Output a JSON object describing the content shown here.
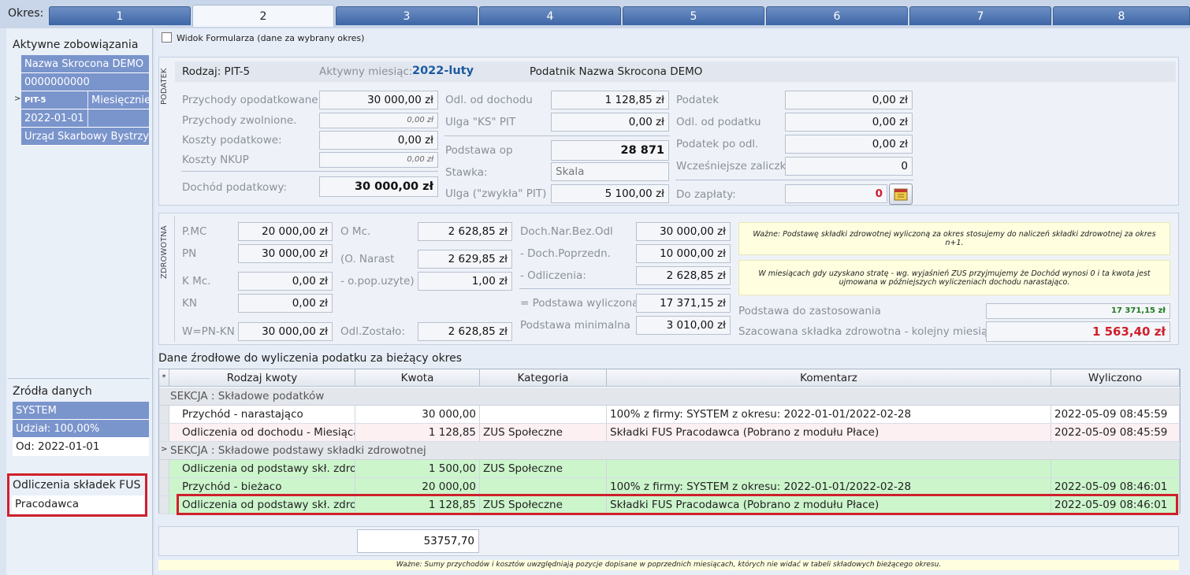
{
  "tabs": {
    "okres_label": "Okres:",
    "items": [
      "1",
      "2",
      "3",
      "4",
      "5",
      "6",
      "7",
      "8"
    ],
    "active_index": 1
  },
  "left": {
    "aktywne_title": "Aktywne zobowiązania",
    "row_name": "Nazwa Skrocona DEMO",
    "row_nip": "0000000000",
    "row_type": "PIT-5",
    "row_period": "Miesięcznie",
    "row_date": "2022-01-01",
    "row_office": "Urząd Skarbowy Bystrzy",
    "zrodla_title": "Źródła danych",
    "zrodla_system": "SYSTEM",
    "zrodla_udzial": "Udział: 100,00%",
    "zrodla_od": "Od: 2022-01-01",
    "fus_title": "Odliczenia składek FUS",
    "fus_value": "Pracodawca"
  },
  "form": {
    "view_label": "Widok Formularza (dane za wybrany okres)"
  },
  "podatek": {
    "section_label": "PODATEK",
    "rodzaj": "Rodzaj: PIT-5",
    "aktywny_label": "Aktywny miesiąc:",
    "aktywny_value": "2022-luty",
    "podatnik": "Podatnik Nazwa Skrocona DEMO",
    "przychody_opod_label": "Przychody opodatkowane:",
    "przychody_opod": "30 000,00 zł",
    "przychody_zw_label": "Przychody zwolnione.",
    "przychody_zw": "0,00 zł",
    "koszty_label": "Koszty podatkowe:",
    "koszty": "0,00 zł",
    "koszty_nkup_label": "Koszty NKUP",
    "koszty_nkup": "0,00 zł",
    "dochod_label": "Dochód podatkowy:",
    "dochod": "30 000,00 zł",
    "odl_doch_label": "Odl. od dochodu",
    "odl_doch": "1 128,85 zł",
    "ulga_ks_label": "Ulga \"KS\" PIT",
    "ulga_ks": "0,00 zł",
    "podstawa_op_label": "Podstawa op",
    "podstawa_op": "28 871",
    "stawka_label": "Stawka:",
    "stawka": "Skala",
    "ulga_zw_label": "Ulga (\"zwykła\" PIT)",
    "ulga_zw": "5 100,00 zł",
    "podatek_label": "Podatek",
    "podatek": "0,00 zł",
    "odl_pod_label": "Odl. od podatku",
    "odl_pod": "0,00 zł",
    "pod_po_odl_label": "Podatek po odl.",
    "pod_po_odl": "0,00 zł",
    "wczesniejsze_label": "Wcześniejsze zaliczki",
    "wczesniejsze": "0",
    "do_zaplaty_label": "Do zapłaty:",
    "do_zaplaty": "0"
  },
  "zdrowotna": {
    "section_label": "ZDROWOTNA",
    "pmc_label": "P.MC",
    "pmc": "20 000,00 zł",
    "pn_label": "PN",
    "pn": "30 000,00 zł",
    "kmc_label": "K Mc.",
    "kmc": "0,00 zł",
    "kn_label": "KN",
    "kn": "0,00 zł",
    "w_label": "W=PN-KN",
    "w": "30 000,00 zł",
    "omc_label": "O Mc.",
    "omc": "2 628,85 zł",
    "onarast_label": "(O. Narast",
    "onarast": "2 629,85 zł",
    "opop_label": "- o.pop.uzyte)",
    "opop": "1,00 zł",
    "odl_zost_label": "Odl.Zostało:",
    "odl_zost": "2 628,85 zł",
    "dochnar_label": "Doch.Nar.Bez.Odl",
    "dochnar": "30 000,00 zł",
    "dochpop_label": "- Doch.Poprzedn.",
    "dochpop": "10 000,00 zł",
    "odliczenia_label": "- Odliczenia:",
    "odliczenia": "2 628,85 zł",
    "podst_wyl_label": "= Podstawa wyliczona",
    "podst_wyl": "17 371,15 zł",
    "podst_min_label": "Podstawa minimalna",
    "podst_min": "3 010,00 zł",
    "note1": "Ważne: Podstawę składki zdrowotnej wyliczoną za okres stosujemy do naliczeń składki zdrowotnej za okres n+1.",
    "note2": "W miesiącach gdy uzyskano stratę - wg. wyjaśnień ZUS przyjmujemy że Dochód wynosi 0 i ta kwota jest ujmowana w późniejszych wyliczeniach dochodu narastająco.",
    "podst_zast_label": "Podstawa do zastosowania",
    "podst_zast": "17 371,15 zł",
    "szac_label": "Szacowana składka zdrowotna - kolejny miesiąc",
    "szac": "1 563,40 zł"
  },
  "grid": {
    "title": "Dane źrodłowe do wyliczenia podatku za bieżący okres",
    "headers": [
      "Rodzaj kwoty",
      "Kwota",
      "Kategoria",
      "Komentarz",
      "Wyliczono"
    ],
    "section1": "SEKCJA : Składowe podatków",
    "section2": "SEKCJA : Składowe podstawy składki zdrowotnej",
    "rows": [
      {
        "rodzaj": "Przychód - narastająco",
        "kwota": "30 000,00",
        "kategoria": "",
        "komentarz": "100% z firmy: SYSTEM z okresu: 2022-01-01/2022-02-28",
        "wyliczono": "2022-05-09 08:45:59"
      },
      {
        "rodzaj": "Odliczenia od dochodu - Miesiąca",
        "kwota": "1 128,85",
        "kategoria": "ZUS Społeczne",
        "komentarz": "Składki FUS Pracodawca (Pobrano z modułu Płace)",
        "wyliczono": "2022-05-09 08:45:59"
      },
      {
        "rodzaj": "Odliczenia od podstawy skł. zdrowotnej",
        "kwota": "1 500,00",
        "kategoria": "ZUS Społeczne",
        "komentarz": "",
        "wyliczono": ""
      },
      {
        "rodzaj": "Przychód - bieżaco",
        "kwota": "20 000,00",
        "kategoria": "",
        "komentarz": "100% z firmy: SYSTEM z okresu: 2022-01-01/2022-02-28",
        "wyliczono": "2022-05-09 08:46:01"
      },
      {
        "rodzaj": "Odliczenia od podstawy skł. zdrowotnej",
        "kwota": "1 128,85",
        "kategoria": "ZUS Społeczne",
        "komentarz": "Składki FUS Pracodawca (Pobrano z modułu Płace)",
        "wyliczono": "2022-05-09 08:46:01"
      }
    ],
    "total": "53757,70"
  },
  "footer_note": "Ważne: Sumy przychodów i kosztów uwzględniają pozycje dopisane w poprzednich miesiącach, których nie widać w tabeli składowych bieżącego okresu.",
  "colors": {
    "tab_blue": "#3e66a6",
    "row_blue": "#7a94cc",
    "green_row": "#ccf5cc",
    "highlight_red": "#d0202c",
    "red_value": "#d0202c"
  }
}
